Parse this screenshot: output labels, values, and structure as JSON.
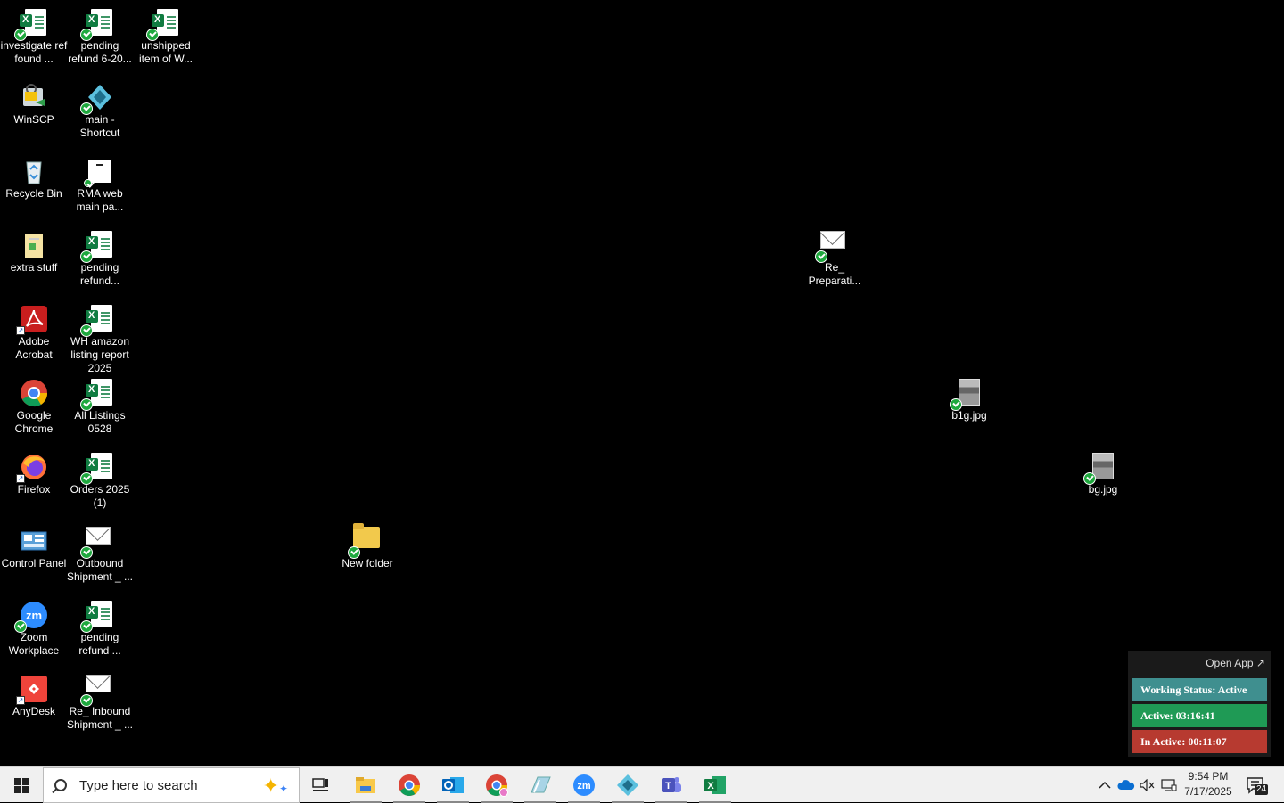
{
  "desktop": {
    "icons": [
      {
        "label": "investigate ref found ...",
        "type": "excel"
      },
      {
        "label": "pending refund 6-20...",
        "type": "excel"
      },
      {
        "label": "unshipped item of W...",
        "type": "excel"
      },
      {
        "label": "WinSCP",
        "type": "winscp"
      },
      {
        "label": "main - Shortcut",
        "type": "app"
      },
      {
        "label": "Recycle Bin",
        "type": "recycle"
      },
      {
        "label": "RMA web main pa...",
        "type": "doc"
      },
      {
        "label": "extra stuff",
        "type": "folder"
      },
      {
        "label": "pending refund...",
        "type": "excel"
      },
      {
        "label": "Adobe Acrobat",
        "type": "acrobat"
      },
      {
        "label": "WH amazon listing report 2025",
        "type": "excel"
      },
      {
        "label": "Google Chrome",
        "type": "chrome"
      },
      {
        "label": "All Listings 0528",
        "type": "excel"
      },
      {
        "label": "Firefox",
        "type": "firefox"
      },
      {
        "label": "Orders 2025 (1)",
        "type": "excel"
      },
      {
        "label": "Control Panel",
        "type": "control"
      },
      {
        "label": "Outbound Shipment _ ...",
        "type": "mail"
      },
      {
        "label": "Zoom Workplace",
        "type": "zoom"
      },
      {
        "label": "pending refund ...",
        "type": "excel"
      },
      {
        "label": "AnyDesk",
        "type": "anydesk"
      },
      {
        "label": "Re_ Inbound Shipment _ ...",
        "type": "mail"
      },
      {
        "label": "New folder",
        "type": "folder"
      },
      {
        "label": "Re_ Preparati...",
        "type": "mail"
      },
      {
        "label": "b1g.jpg",
        "type": "photo"
      },
      {
        "label": "bg.jpg",
        "type": "photo"
      }
    ]
  },
  "taskbar": {
    "search_placeholder": "Type here to search",
    "apps": [
      "task-view",
      "file-explorer",
      "chrome",
      "outlook",
      "chrome-profile",
      "paint",
      "zoom",
      "app",
      "teams",
      "excel"
    ],
    "clock_time": "9:54 PM",
    "clock_date": "7/17/2025",
    "notification_count": "24"
  },
  "widget": {
    "open_app": "Open App ↗",
    "working_status": "Working Status: Active",
    "active": "Active: 03:16:41",
    "inactive": "In Active: 00:11:07",
    "colors": {
      "status": "#3f8f8f",
      "active": "#1f9a55",
      "inactive": "#b73a30"
    }
  }
}
